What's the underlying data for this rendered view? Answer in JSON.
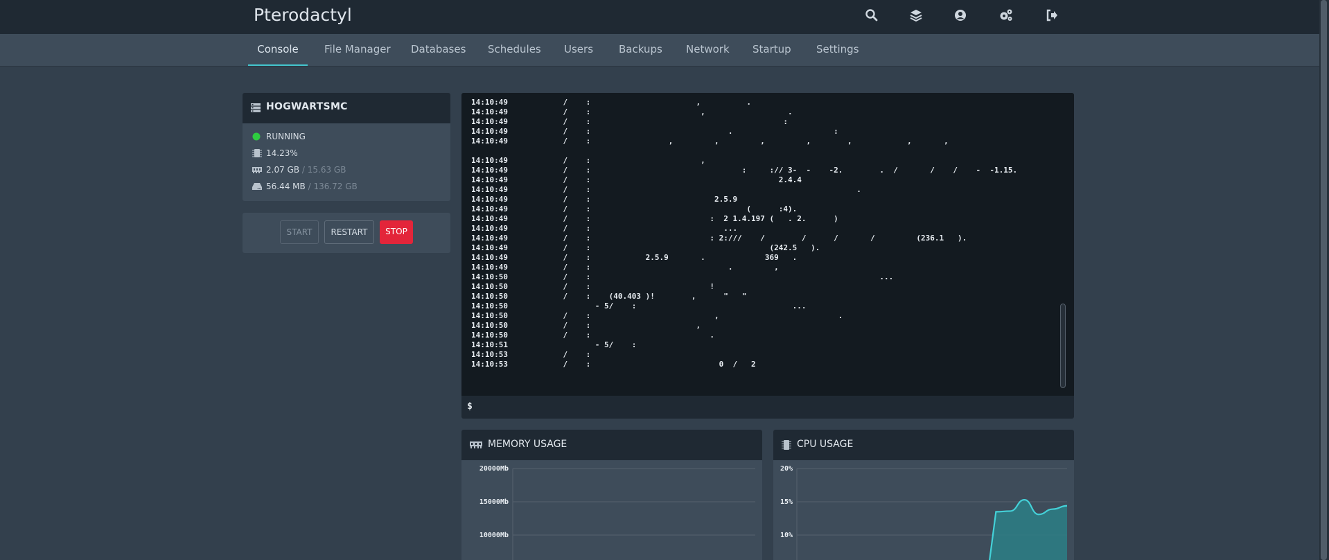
{
  "app": {
    "title": "Pterodactyl"
  },
  "topbar": {
    "icons": [
      "search-icon",
      "layers-icon",
      "account-icon",
      "cogs-icon",
      "sign-out-icon"
    ]
  },
  "nav": {
    "tabs": [
      {
        "label": "Console",
        "active": true
      },
      {
        "label": "File Manager"
      },
      {
        "label": "Databases"
      },
      {
        "label": "Schedules"
      },
      {
        "label": "Users"
      },
      {
        "label": "Backups"
      },
      {
        "label": "Network"
      },
      {
        "label": "Startup"
      },
      {
        "label": "Settings"
      }
    ]
  },
  "server": {
    "name": "HOGWARTSMC",
    "status": "RUNNING",
    "status_color": "#2ecc40",
    "cpu": "14.23%",
    "memory_used": "2.07 GB",
    "memory_limit": "/ 15.63 GB",
    "disk_used": "56.44 MB",
    "disk_limit": "/ 136.72 GB"
  },
  "power": {
    "start": "START",
    "restart": "RESTART",
    "stop": "STOP",
    "stop_color": "#e3253a"
  },
  "console": {
    "prompt": "$",
    "input_value": "",
    "lines": [
      "14:10:49            /    :                       ,          .",
      "14:10:49            /    :                        ,                  .",
      "14:10:49            /    :                                          :",
      "14:10:49            /    :                              .                      :",
      "14:10:49            /    :                 ,         ,         ,         ,        ,            ,       ,",
      "",
      "14:10:49            /    :                        ,",
      "14:10:49            /    :                                 :     :// 3-  -    -2.        .  /       /    /    -  -1.15.",
      "14:10:49            /    :                                         2.4.4",
      "14:10:49            /    :                                                          .",
      "14:10:49            /    :                           2.5.9",
      "14:10:49            /    :                                  (      :4).",
      "14:10:49            /    :                          :  2 1.4.197 (   . 2.      )",
      "14:10:49            /    :                             ...",
      "14:10:49            /    :                          : 2:///    /        /      /       /         (236.1   ).",
      "14:10:49            /    :                                       (242.5   ).",
      "14:10:49            /    :            2.5.9       .             369   .",
      "14:10:49            /    :                              .         ,",
      "14:10:50            /    :                                                               ...",
      "14:10:50            /    :                          !",
      "14:10:50            /    :    (40.403 )!        ,      \"   \"",
      "14:10:50                   - 5/    :                                  ...",
      "14:10:50            /    :                           ,                          .",
      "14:10:50            /    :                       ,",
      "14:10:50            /    :                          .",
      "14:10:51                   - 5/    :",
      "14:10:53            /    :",
      "14:10:53            /    :                            0  /   2"
    ]
  },
  "memory_chart": {
    "title": "MEMORY USAGE",
    "y_ticks": [
      "20000Mb",
      "15000Mb",
      "10000Mb"
    ]
  },
  "cpu_chart": {
    "title": "CPU USAGE",
    "y_ticks": [
      "20%",
      "15%",
      "10%"
    ],
    "line_color": "#44d1d8",
    "fill_color": "#2b7f86"
  },
  "chart_data": [
    {
      "type": "line",
      "title": "MEMORY USAGE",
      "ylim": [
        0,
        20000
      ],
      "yticks": [
        "20000Mb",
        "15000Mb",
        "10000Mb"
      ],
      "series": [
        {
          "values": []
        }
      ]
    },
    {
      "type": "area",
      "title": "CPU USAGE",
      "ylim": [
        0,
        20
      ],
      "yticks": [
        "20%",
        "15%",
        "10%"
      ],
      "x": [
        0,
        1,
        2,
        3,
        4,
        5,
        6,
        7,
        8,
        9,
        10,
        11,
        12,
        13,
        14,
        15,
        16,
        17,
        18,
        19
      ],
      "series": [
        {
          "values": [
            0,
            0,
            0,
            0,
            0,
            0,
            0,
            0,
            0,
            0,
            0,
            0,
            0,
            0,
            13.5,
            13.6,
            15.3,
            13.1,
            13.9,
            14.4
          ]
        }
      ],
      "grid": true
    }
  ]
}
